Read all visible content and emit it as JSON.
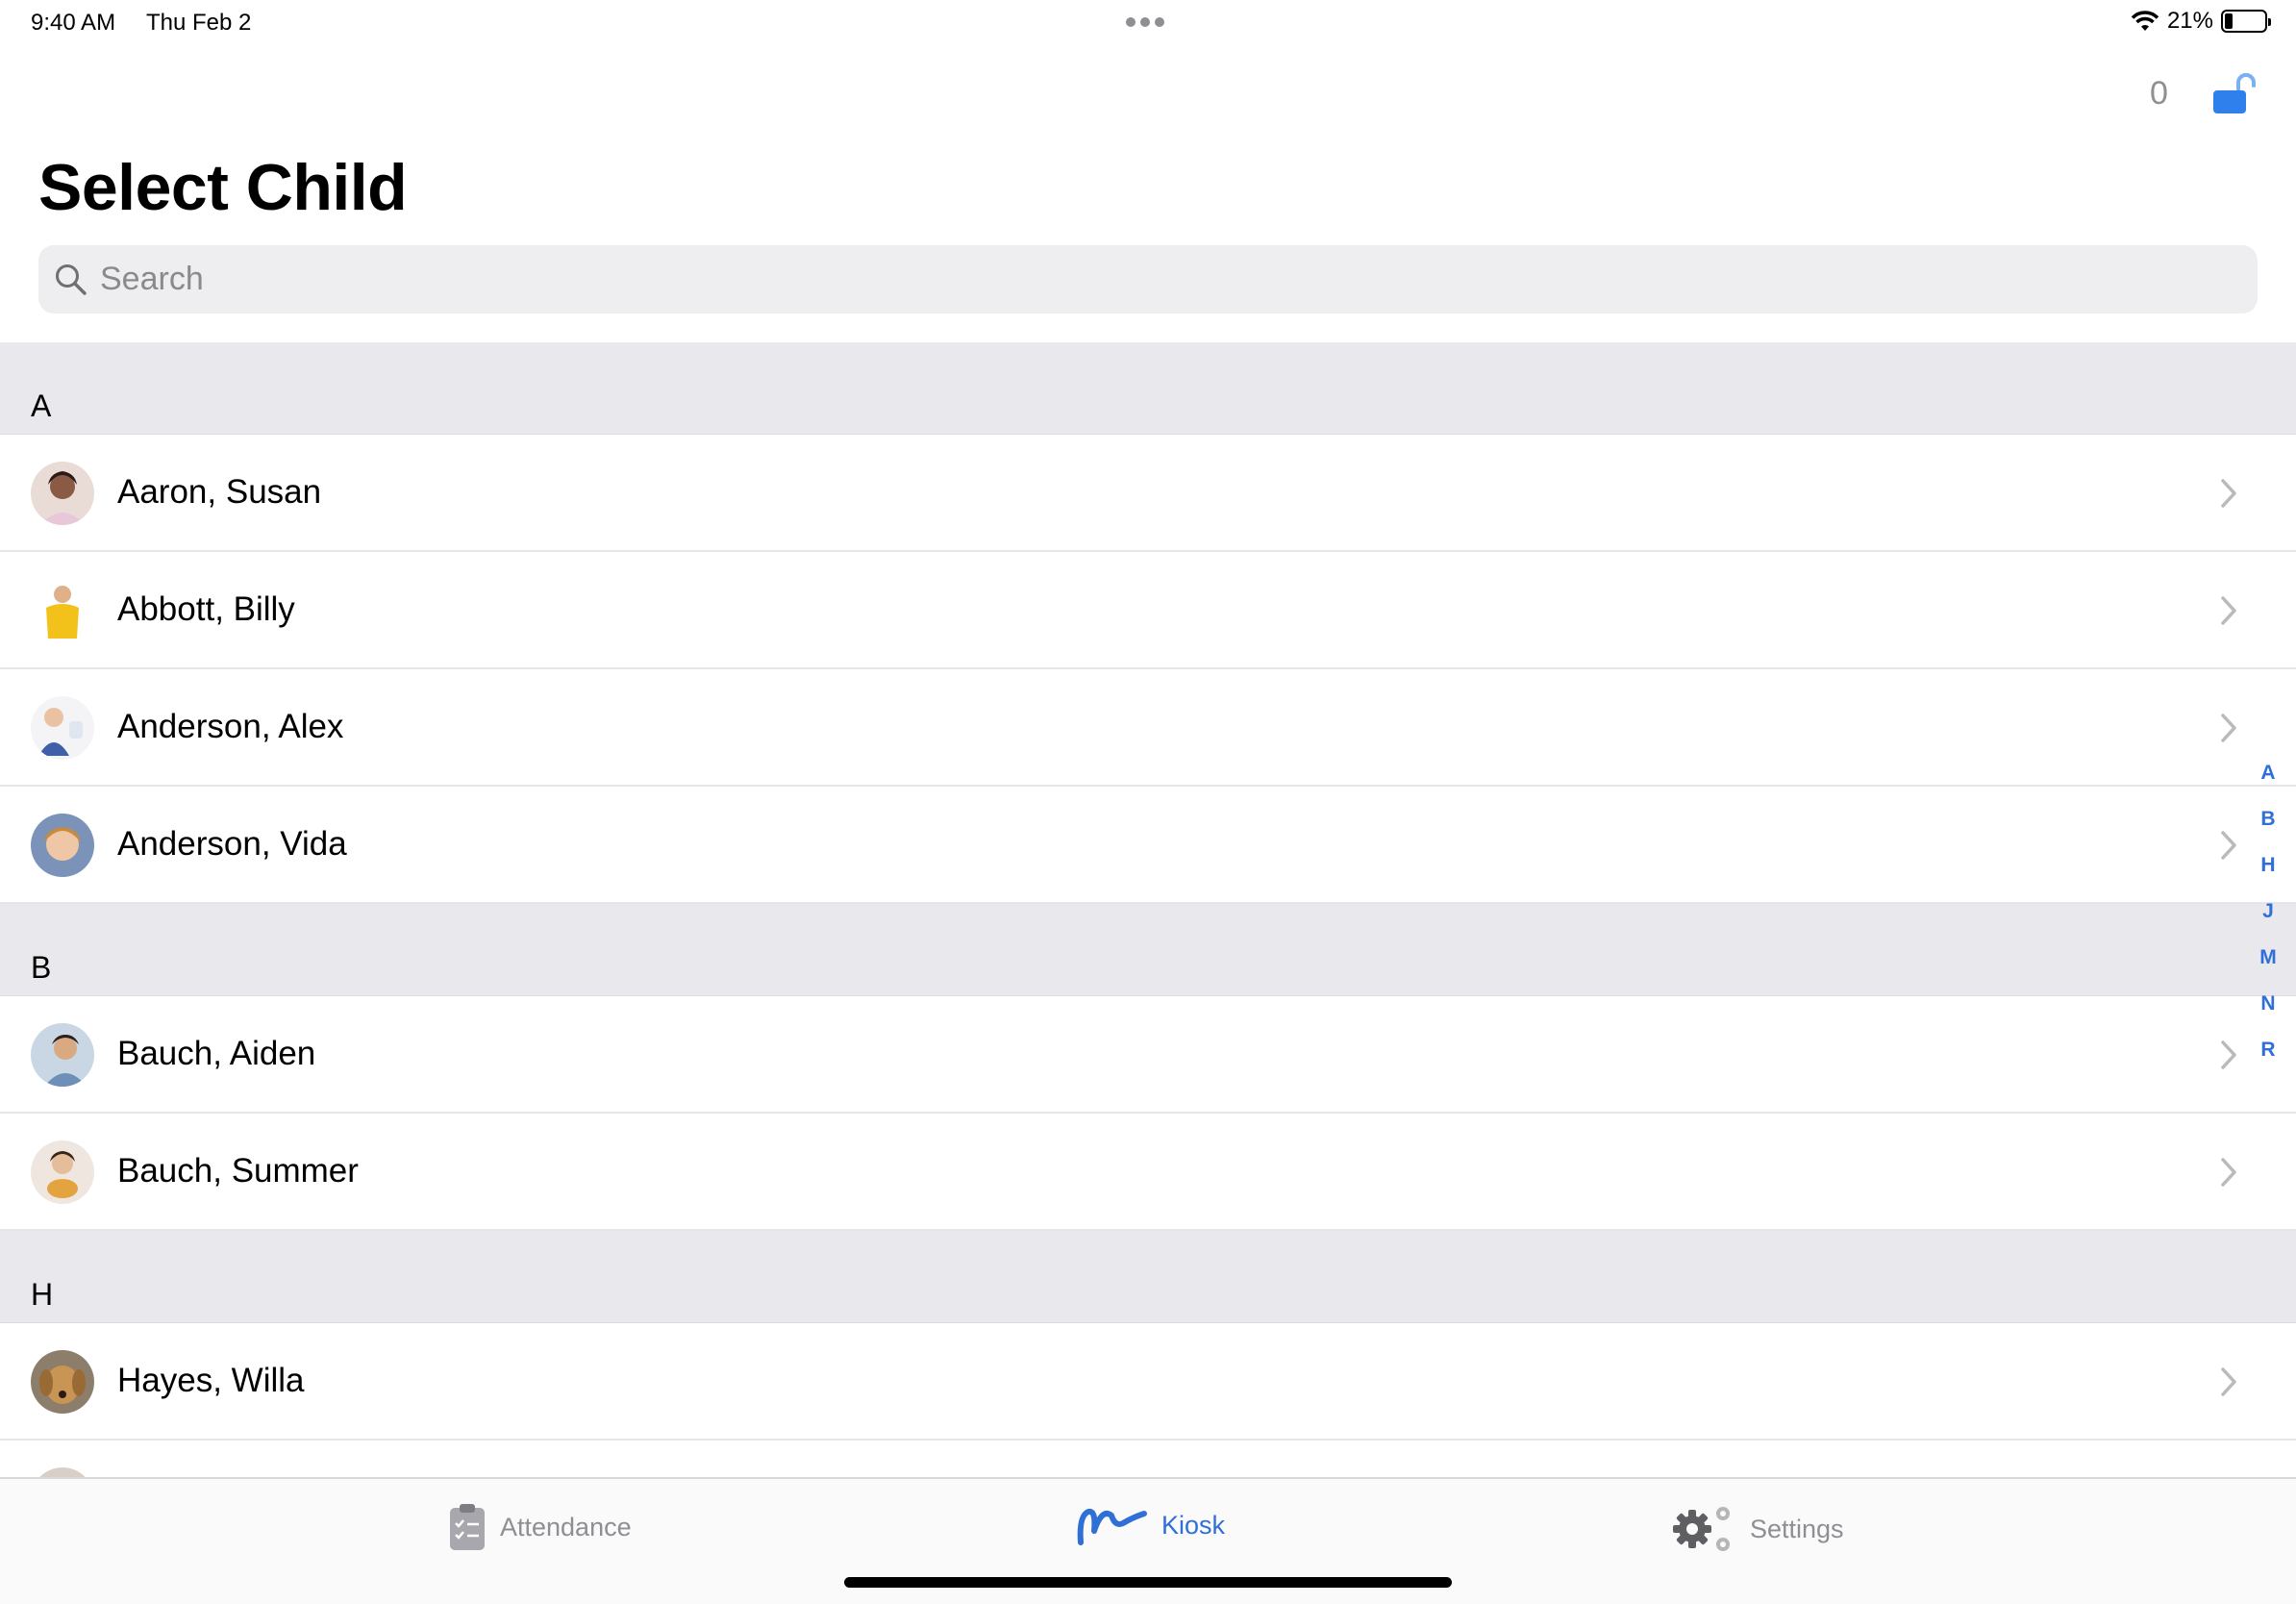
{
  "status_bar": {
    "time": "9:40 AM",
    "date": "Thu Feb 2",
    "battery": "21%"
  },
  "nav": {
    "count": "0"
  },
  "title": "Select Child",
  "search": {
    "placeholder": "Search",
    "value": ""
  },
  "sections": [
    {
      "letter": "A",
      "children": [
        "Aaron, Susan",
        "Abbott, Billy",
        "Anderson, Alex",
        "Anderson, Vida"
      ]
    },
    {
      "letter": "B",
      "children": [
        "Bauch, Aiden",
        "Bauch, Summer"
      ]
    },
    {
      "letter": "H",
      "children": [
        "Hayes, Willa"
      ]
    }
  ],
  "index_letters": [
    "A",
    "B",
    "H",
    "J",
    "M",
    "N",
    "R"
  ],
  "tabs": {
    "attendance": "Attendance",
    "kiosk": "Kiosk",
    "settings": "Settings",
    "active": "kiosk"
  },
  "colors": {
    "accent": "#2f6fd6",
    "section_bg": "#e9e9ed",
    "inactive": "#8e8e93"
  },
  "icons": [
    "wifi-icon",
    "battery-icon",
    "unlock-icon",
    "search-icon",
    "chevron-right-icon",
    "clipboard-icon",
    "signature-icon",
    "gears-icon"
  ]
}
